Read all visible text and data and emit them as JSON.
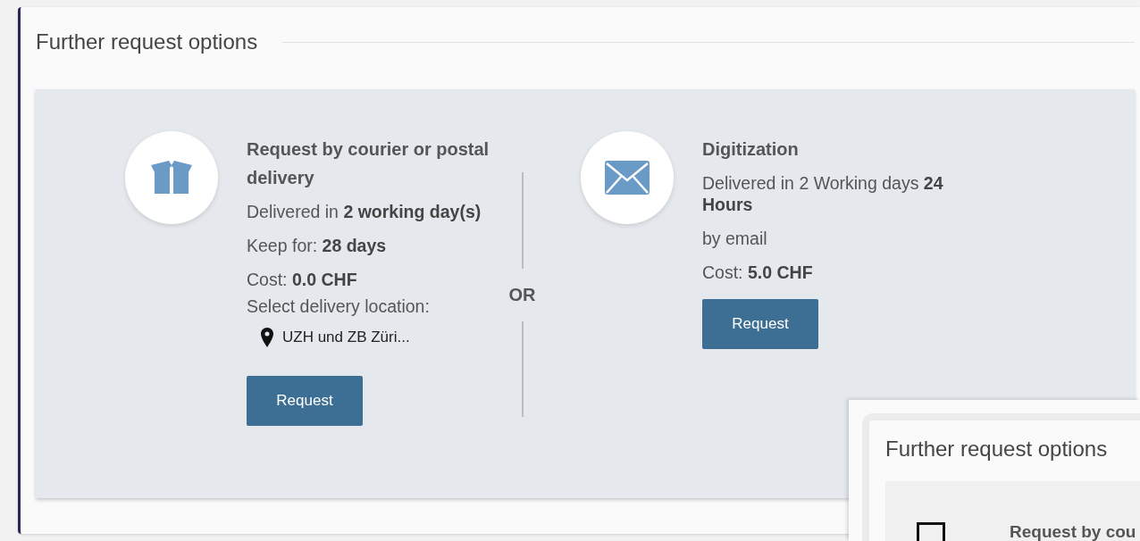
{
  "panel": {
    "title": "Further request options"
  },
  "options": [
    {
      "kind": "box",
      "title": "Request by courier or postal delivery",
      "lines": [
        {
          "kind": "text",
          "text": "Delivered in **2 working day(s)**"
        },
        {
          "kind": "text",
          "text": "Keep for: **28 days**"
        },
        {
          "kind": "tight",
          "text": "Cost:  **0.0  CHF**"
        },
        {
          "kind": "tight",
          "text": "Select delivery location:"
        },
        {
          "kind": "location",
          "text": "UZH und ZB Züri..."
        }
      ],
      "button": "Request"
    },
    {
      "kind": "envelope",
      "title": "Digitization",
      "lines": [
        {
          "kind": "text",
          "text": "Delivered in 2 Working days **24 Hours**"
        },
        {
          "kind": "text",
          "text": "by email"
        },
        {
          "kind": "text",
          "text": "Cost:  **5.0  CHF**"
        }
      ],
      "button": "Request"
    }
  ],
  "separator": "OR",
  "overlay": {
    "title": "Further request options",
    "option_title": "Request by cou"
  }
}
